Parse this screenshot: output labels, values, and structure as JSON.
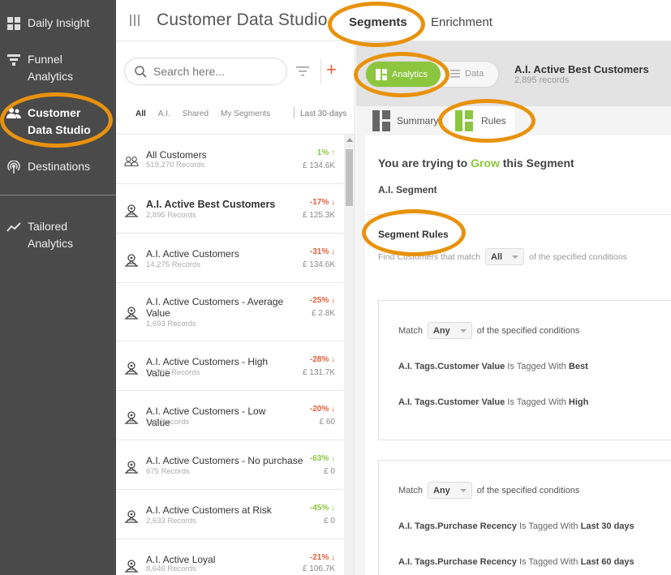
{
  "sidebar": {
    "items": [
      {
        "label": "Daily Insight",
        "icon": "grid-icon"
      },
      {
        "label": "Funnel Analytics",
        "icon": "funnel-icon"
      },
      {
        "label": "Customer Data Studio",
        "icon": "users-icon",
        "active": true
      },
      {
        "label": "Destinations",
        "icon": "broadcast-icon"
      },
      {
        "label": "Tailored Analytics",
        "icon": "trend-icon"
      }
    ]
  },
  "header": {
    "title": "Customer Data Studio",
    "tabs": [
      {
        "label": "Segments",
        "active": true
      },
      {
        "label": "Enrichment"
      }
    ]
  },
  "list": {
    "search_placeholder": "Search here...",
    "add_label": "+",
    "filters": [
      "All",
      "A.I.",
      "Shared",
      "My Segments"
    ],
    "date_filter": "Last 30-days",
    "segments": [
      {
        "name": "All Customers",
        "records": "519,270 Records",
        "change": "1%",
        "dir": "up",
        "value": "£ 134.6K",
        "icon": "people-icon"
      },
      {
        "name": "A.I. Active Best Customers",
        "records": "2,895 Records",
        "change": "-17%",
        "dir": "down",
        "value": "£ 125.3K",
        "icon": "ai-icon",
        "selected": true
      },
      {
        "name": "A.I. Active Customers",
        "records": "14,275 Records",
        "change": "-31%",
        "dir": "down",
        "value": "£ 134.6K",
        "icon": "ai-icon"
      },
      {
        "name": "A.I. Active Customers - Average Value",
        "records": "1,693 Records",
        "change": "-25%",
        "dir": "down",
        "value": "£ 2.8K",
        "icon": "ai-icon"
      },
      {
        "name": "A.I. Active Customers - High Value",
        "records": "11,781 Records",
        "change": "-28%",
        "dir": "down",
        "value": "£ 131.7K",
        "icon": "ai-icon"
      },
      {
        "name": "A.I. Active Customers - Low Value",
        "records": "112 Records",
        "change": "-20%",
        "dir": "down",
        "value": "£ 60",
        "icon": "ai-icon"
      },
      {
        "name": "A.I. Active Customers - No purchase",
        "records": "675 Records",
        "change": "-63%",
        "dir": "up",
        "value": "£ 0",
        "icon": "ai-icon"
      },
      {
        "name": "A.I. Active Customers at Risk",
        "records": "2,633 Records",
        "change": "-45%",
        "dir": "up",
        "value": "£ 0",
        "icon": "ai-icon"
      },
      {
        "name": "A.I. Active Loyal",
        "records": "8,646 Records",
        "change": "-21%",
        "dir": "down",
        "value": "£ 106.7K",
        "icon": "ai-icon"
      }
    ]
  },
  "detail": {
    "toggle_on": "Analytics",
    "toggle_off": "Data",
    "segment_name": "A.I. Active Best Customers",
    "segment_records": "2,895 records",
    "subtabs": [
      {
        "label": "Summary"
      },
      {
        "label": "Rules",
        "active": true
      }
    ],
    "grow_prefix": "You are trying to",
    "grow_word": "Grow",
    "grow_suffix": "this Segment",
    "ai_segment": "A.I. Segment",
    "rules_title": "Segment Rules",
    "find_prefix": "Find Customers that match",
    "find_select": "All",
    "find_suffix": "of the specified conditions",
    "groups": [
      {
        "match_prefix": "Match",
        "match_select": "Any",
        "match_suffix": "of the specified conditions",
        "conditions": [
          {
            "field": "A.I. Tags.Customer Value",
            "op": "Is Tagged With",
            "value": "Best"
          },
          {
            "field": "A.I. Tags.Customer Value",
            "op": "Is Tagged With",
            "value": "High"
          }
        ]
      },
      {
        "match_prefix": "Match",
        "match_select": "Any",
        "match_suffix": "of the specified conditions",
        "conditions": [
          {
            "field": "A.I. Tags.Purchase Recency",
            "op": "Is Tagged With",
            "value": "Last 30 days"
          },
          {
            "field": "A.I. Tags.Purchase Recency",
            "op": "Is Tagged With",
            "value": "Last 60 days"
          }
        ]
      }
    ]
  },
  "colors": {
    "sidebar": "#4a4a4a",
    "accent_green": "#8cc63f",
    "negative": "#e0603a",
    "highlight": "#e8920c"
  }
}
